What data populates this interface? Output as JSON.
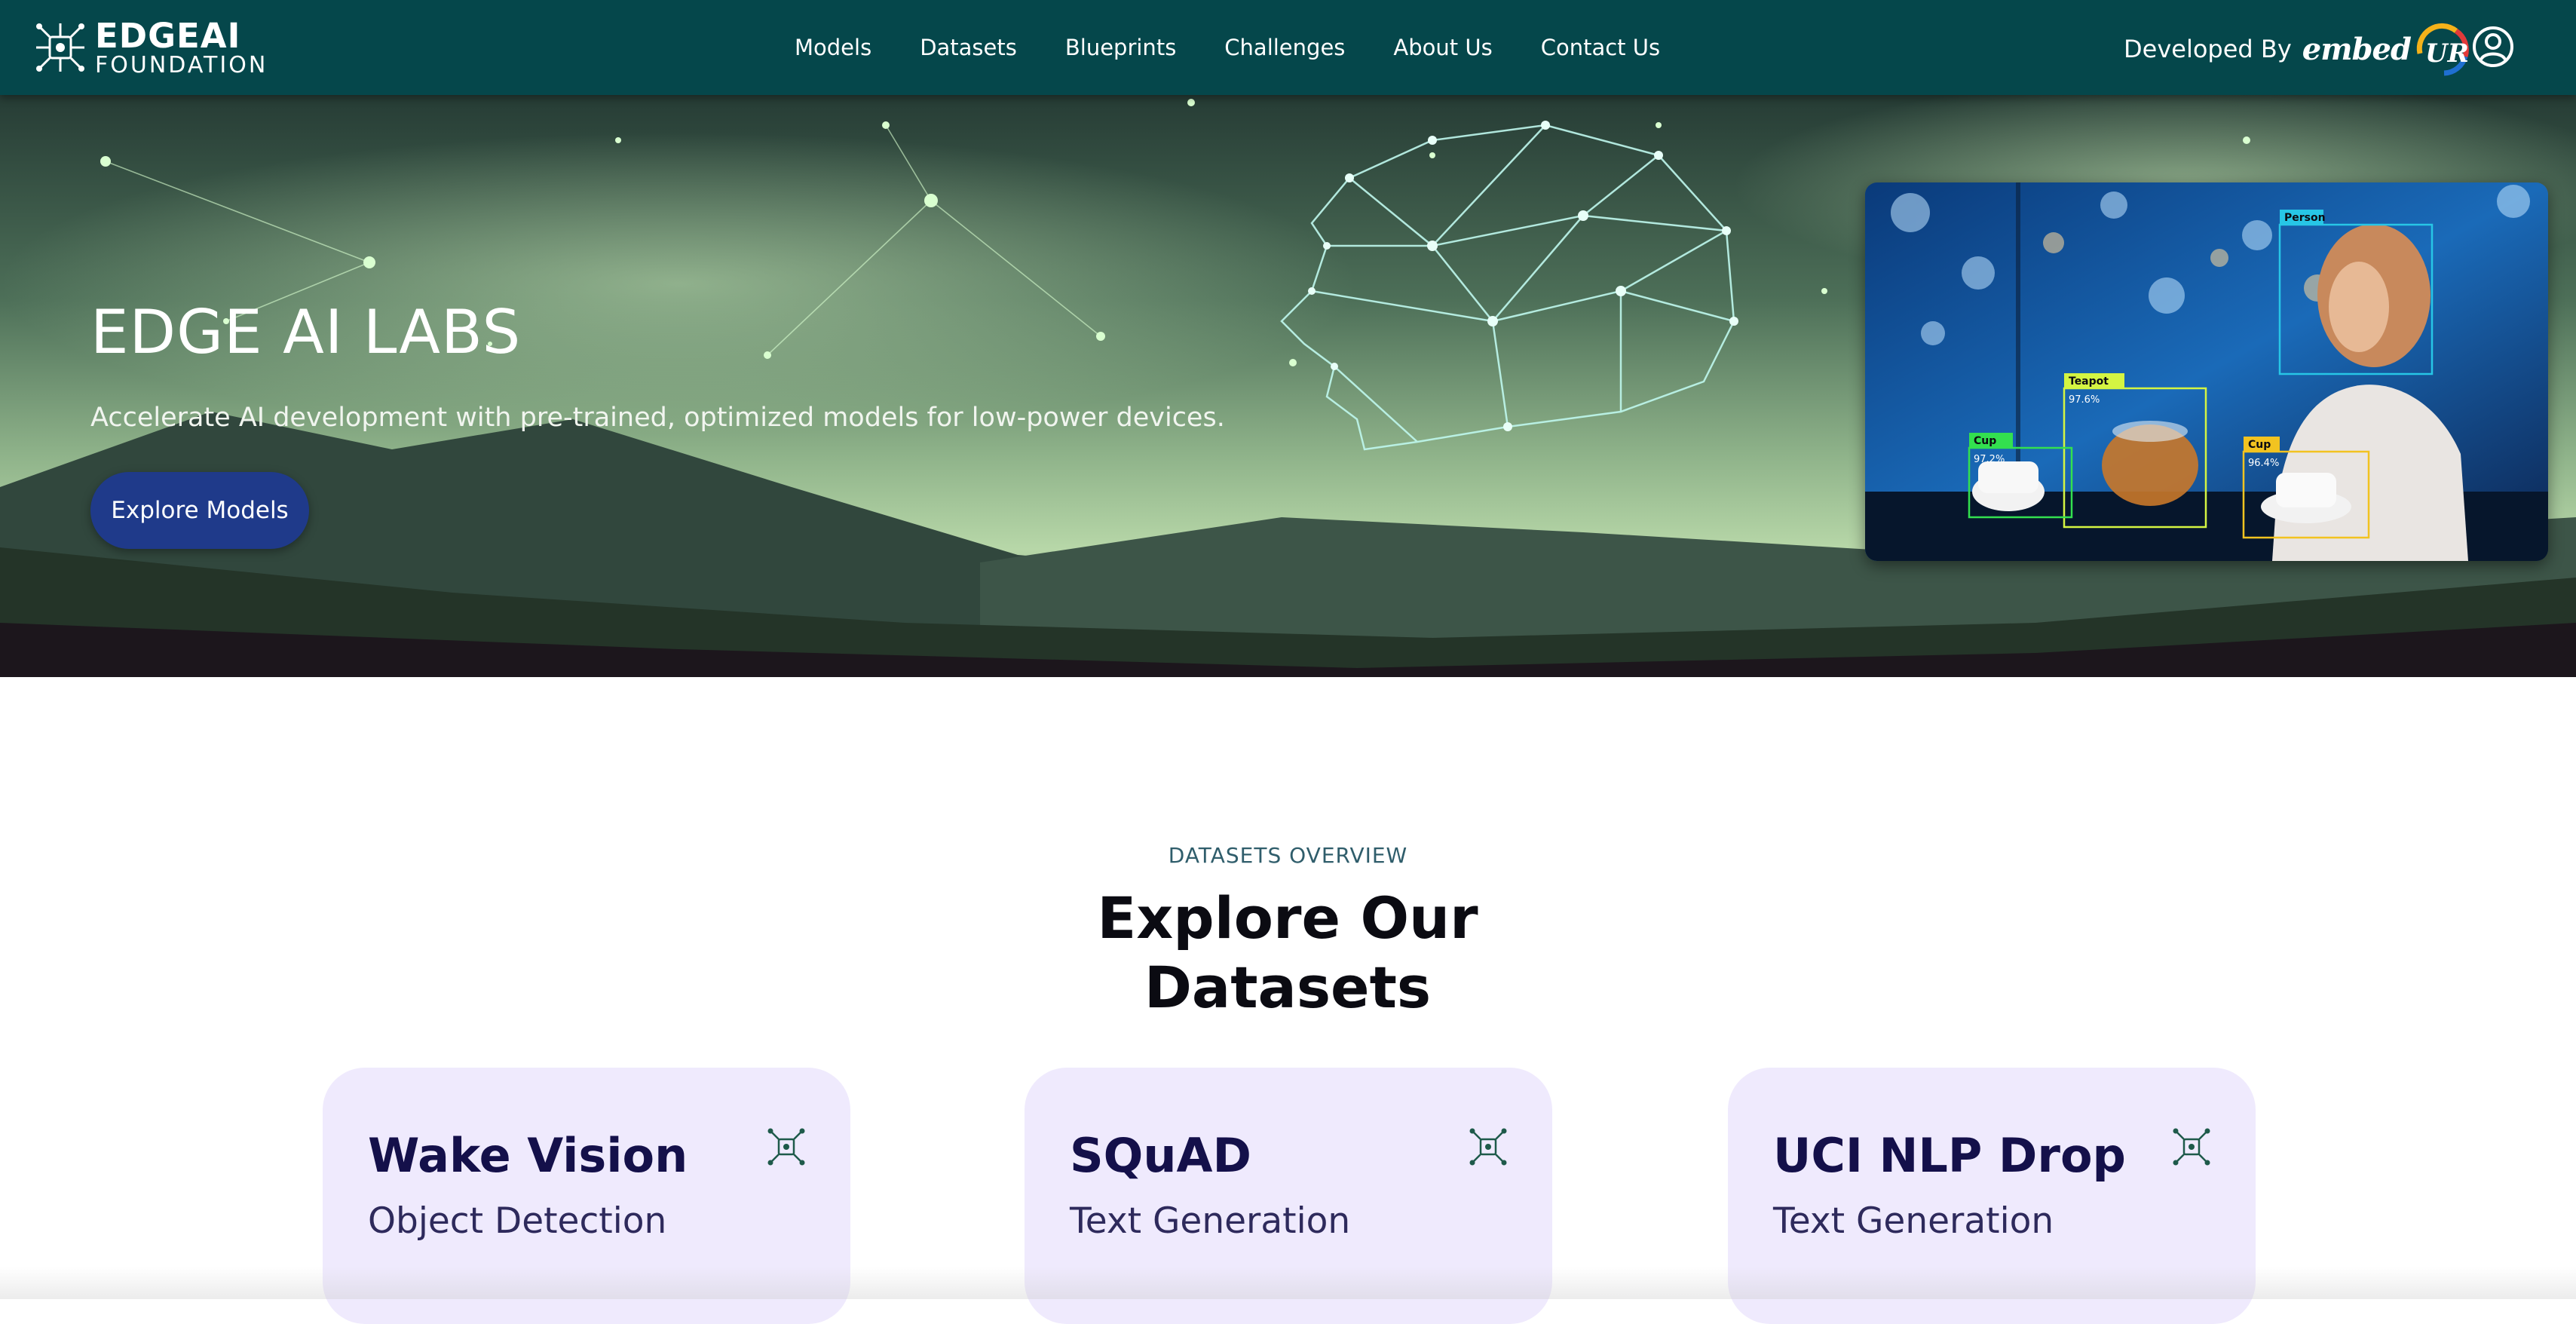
{
  "header": {
    "logo": {
      "line1": "EDGEAI",
      "line2": "FOUNDATION"
    },
    "nav": [
      "Models",
      "Datasets",
      "Blueprints",
      "Challenges",
      "About Us",
      "Contact Us"
    ],
    "developed_by": {
      "label": "Developed By",
      "brand": "embed",
      "badge": "UR"
    },
    "account_icon": "user-circle-icon"
  },
  "hero": {
    "title": "EDGE AI LABS",
    "subtitle": "Accelerate AI development with pre-trained, optimized models for low-power devices.",
    "cta": "Explore Models",
    "detections": [
      {
        "label": "Person",
        "confidence": "",
        "color": "#27c6e6"
      },
      {
        "label": "Teapot",
        "confidence": "97.6%",
        "color": "#d4f542"
      },
      {
        "label": "Cup",
        "confidence": "97.2%",
        "color": "#33e04f"
      },
      {
        "label": "Cup",
        "confidence": "96.4%",
        "color": "#f2c320"
      }
    ]
  },
  "datasets": {
    "kicker": "DATASETS OVERVIEW",
    "title": "Explore Our Datasets",
    "cards": [
      {
        "title": "Wake Vision",
        "subtitle": "Object Detection",
        "icon": "edge-ai-chip-icon"
      },
      {
        "title": "SQuAD",
        "subtitle": "Text Generation",
        "icon": "edge-ai-chip-icon"
      },
      {
        "title": "UCI NLP Drop",
        "subtitle": "Text Generation",
        "icon": "edge-ai-chip-icon"
      }
    ]
  },
  "colors": {
    "navbar": "#05474b",
    "cta": "#1f3a8a",
    "card_bg": "#efeafd",
    "card_title": "#14104a",
    "kicker": "#2f5d6b"
  }
}
